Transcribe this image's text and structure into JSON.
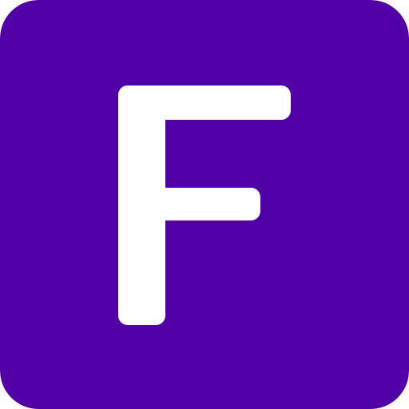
{
  "icon": {
    "letter": "F",
    "semantic": "letter-f-icon",
    "background_color": "#5200A6",
    "foreground_color": "#FFFFFF"
  }
}
